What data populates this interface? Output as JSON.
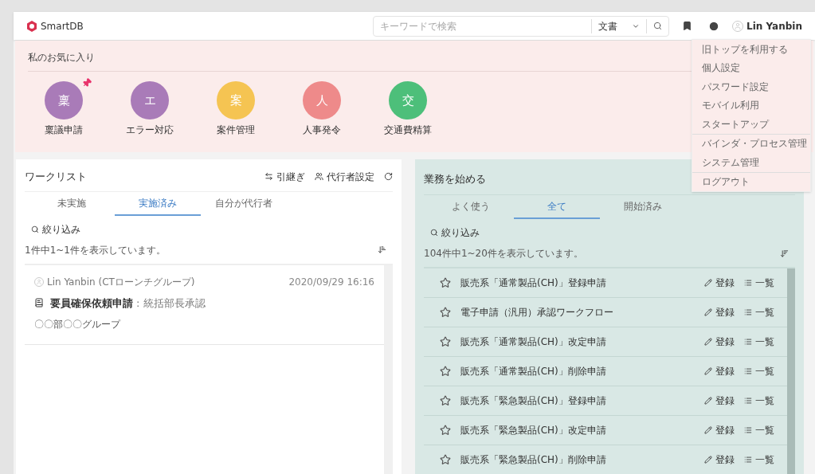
{
  "header": {
    "logo": "SmartDB",
    "search": {
      "placeholder": "キーワードで検索",
      "scope": "文書"
    },
    "user": "Lin Yanbin"
  },
  "user_menu": {
    "groups": [
      [
        "旧トップを利用する",
        "個人設定",
        "パスワード設定",
        "モバイル利用",
        "スタートアップ"
      ],
      [
        "バインダ・プロセス管理",
        "システム管理"
      ],
      [
        "ログアウト"
      ]
    ]
  },
  "favorites": {
    "title": "私のお気に入り",
    "items": [
      {
        "glyph": "稟",
        "label": "稟議申請",
        "color": "#a97bb8",
        "pinned": true
      },
      {
        "glyph": "エ",
        "label": "エラー対応",
        "color": "#a97bb8",
        "pinned": false
      },
      {
        "glyph": "案",
        "label": "案件管理",
        "color": "#f5c452",
        "pinned": false
      },
      {
        "glyph": "人",
        "label": "人事発令",
        "color": "#ee8a8a",
        "pinned": false
      },
      {
        "glyph": "交",
        "label": "交通費精算",
        "color": "#4dbf7a",
        "pinned": false
      }
    ]
  },
  "worklist": {
    "title": "ワークリスト",
    "actions": [
      "引継ぎ",
      "代行者設定"
    ],
    "tabs": [
      {
        "label": "未実施",
        "selected": false
      },
      {
        "label": "実施済み",
        "selected": true
      },
      {
        "label": "自分が代行者",
        "selected": false
      }
    ],
    "filter": "絞り込み",
    "count": "1件中1~1件を表示しています。",
    "items": [
      {
        "user": "Lin Yanbin (CTローンチグループ)",
        "time": "2020/09/29 16:16",
        "title": "要員確保依頼申請",
        "step": ": 統括部長承認",
        "group": "〇〇部〇〇グループ"
      }
    ]
  },
  "start": {
    "title": "業務を始める",
    "tabs": [
      {
        "label": "よく使う",
        "selected": false
      },
      {
        "label": "全て",
        "selected": true
      },
      {
        "label": "開始済み",
        "selected": false
      }
    ],
    "filter": "絞り込み",
    "count": "104件中1~20件を表示しています。",
    "rows": [
      {
        "name": "販売系「通常製品(CH)」登録申請",
        "starred": false,
        "register": "登録",
        "list": "一覧"
      },
      {
        "name": "電子申請（汎用）承認ワークフロー",
        "starred": false,
        "register": "登録",
        "list": "一覧"
      },
      {
        "name": "販売系「通常製品(CH)」改定申請",
        "starred": false,
        "register": "登録",
        "list": "一覧"
      },
      {
        "name": "販売系「通常製品(CH)」削除申請",
        "starred": false,
        "register": "登録",
        "list": "一覧"
      },
      {
        "name": "販売系「緊急製品(CH)」登録申請",
        "starred": false,
        "register": "登録",
        "list": "一覧"
      },
      {
        "name": "販売系「緊急製品(CH)」改定申請",
        "starred": false,
        "register": "登録",
        "list": "一覧"
      },
      {
        "name": "販売系「緊急製品(CH)」削除申請",
        "starred": false,
        "register": "登録",
        "list": "一覧"
      }
    ]
  }
}
